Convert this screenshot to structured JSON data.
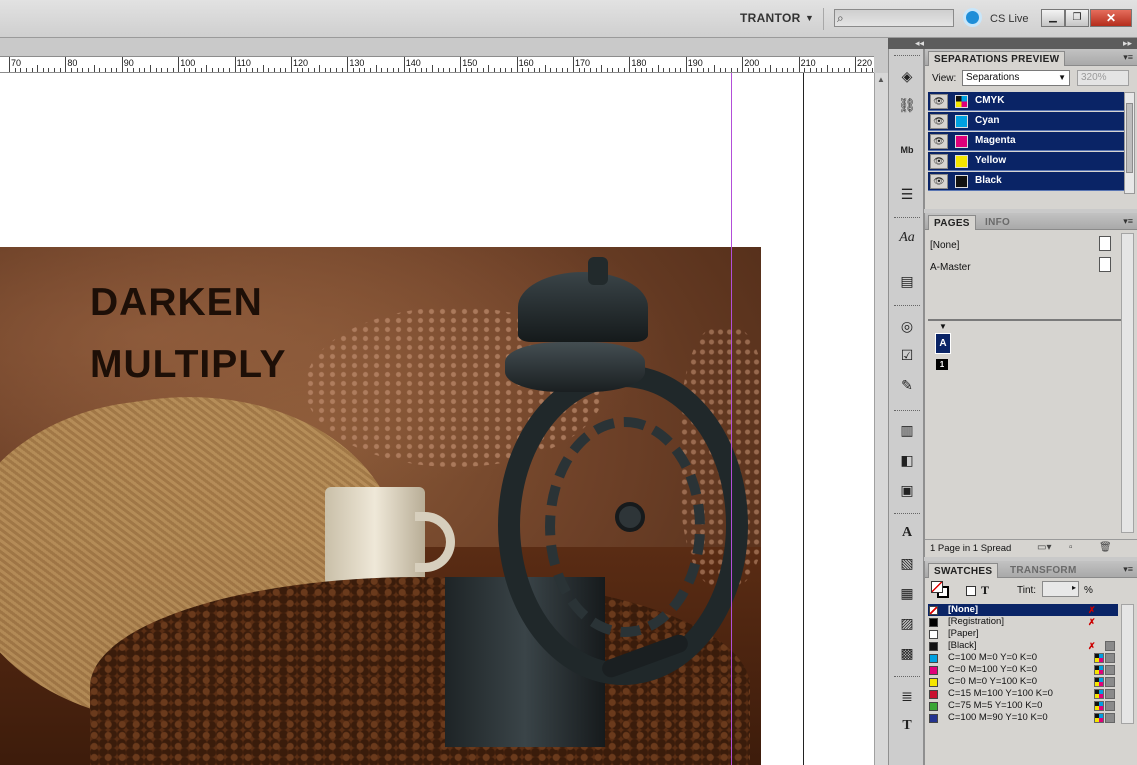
{
  "appbar": {
    "workspace": "TRANTOR",
    "search_placeholder": "",
    "cs_live_label": "CS Live",
    "window_controls": [
      "minimize",
      "restore",
      "close"
    ]
  },
  "ruler": {
    "ticks": [
      "70",
      "80",
      "90",
      "100",
      "110",
      "120",
      "130",
      "140",
      "150",
      "160",
      "170",
      "180",
      "190",
      "200",
      "210",
      "220"
    ]
  },
  "document": {
    "headline_1": "DARKEN",
    "headline_2": "MULTIPLY"
  },
  "tools": [
    "layers-icon",
    "links-icon",
    "mini-bridge-icon",
    "stroke-icon",
    "character-styles-icon",
    "paragraph-icon",
    "effects-icon",
    "checkbox-icon",
    "notes-icon",
    "align-icon",
    "pathfinder-icon",
    "wrap-icon",
    "character-icon",
    "story-icon",
    "table-icon",
    "cell-styles-icon",
    "object-styles-icon",
    "text-wrap-icon",
    "type-icon"
  ],
  "separations": {
    "title": "SEPARATIONS PREVIEW",
    "view_label": "View:",
    "view_value": "Separations",
    "zoom": "320%",
    "inks": [
      {
        "name": "CMYK",
        "color": "cmyk"
      },
      {
        "name": "Cyan",
        "color": "#00a0e0"
      },
      {
        "name": "Magenta",
        "color": "#e0007a"
      },
      {
        "name": "Yellow",
        "color": "#f5e600"
      },
      {
        "name": "Black",
        "color": "#111111"
      }
    ]
  },
  "pages": {
    "tabs": [
      "PAGES",
      "INFO"
    ],
    "none_label": "[None]",
    "master_label": "A-Master",
    "master_page_letter": "A",
    "page_number": "1",
    "footer": "1 Page in 1 Spread"
  },
  "swatches": {
    "tabs": [
      "SWATCHES",
      "TRANSFORM"
    ],
    "format_text_label": "T",
    "tint_label": "Tint:",
    "tint_value": "",
    "tint_unit": "%",
    "items": [
      {
        "name": "[None]",
        "color": "none",
        "selected": true
      },
      {
        "name": "[Registration]",
        "color": "#000000"
      },
      {
        "name": "[Paper]",
        "color": "#ffffff"
      },
      {
        "name": "[Black]",
        "color": "#111111"
      },
      {
        "name": "C=100 M=0 Y=0 K=0",
        "color": "#00a0e0"
      },
      {
        "name": "C=0 M=100 Y=0 K=0",
        "color": "#e0007a"
      },
      {
        "name": "C=0 M=0 Y=100 K=0",
        "color": "#f5e600"
      },
      {
        "name": "C=15 M=100 Y=100 K=0",
        "color": "#c8102e"
      },
      {
        "name": "C=75 M=5 Y=100 K=0",
        "color": "#3aa635"
      },
      {
        "name": "C=100 M=90 Y=10 K=0",
        "color": "#24338f"
      }
    ]
  }
}
